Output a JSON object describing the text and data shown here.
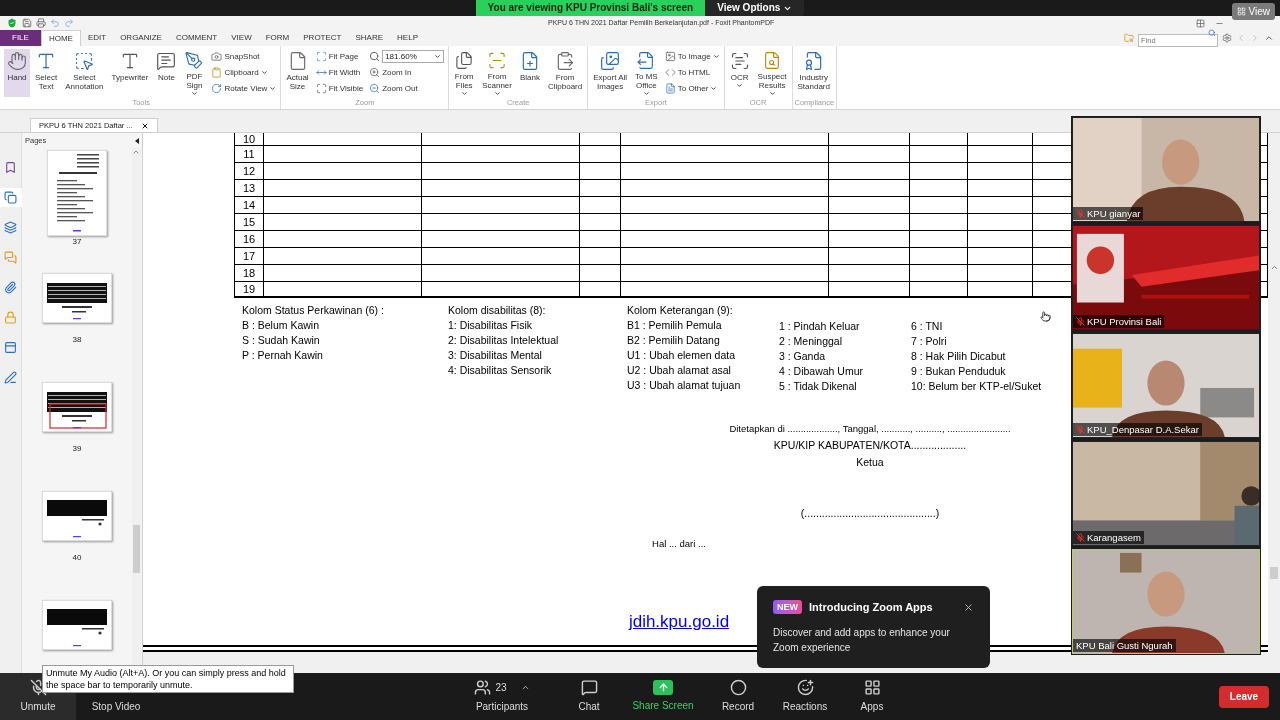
{
  "meeting": {
    "banner": "You are viewing KPU Provinsi Bali's screen",
    "view_options": "View Options",
    "view": "View"
  },
  "app": {
    "title": "PKPU 6 THN 2021 Daftar Pemilih Berkelanjutan.pdf - Foxit PhantomPDF",
    "menu_tabs": [
      {
        "label": "FILE",
        "kind": "file",
        "selected": false
      },
      {
        "label": "HOME",
        "kind": "tab",
        "selected": true
      },
      {
        "label": "EDIT",
        "kind": "tab",
        "selected": false
      },
      {
        "label": "ORGANIZE",
        "kind": "tab",
        "selected": false
      },
      {
        "label": "COMMENT",
        "kind": "tab",
        "selected": false
      },
      {
        "label": "VIEW",
        "kind": "tab",
        "selected": false
      },
      {
        "label": "FORM",
        "kind": "tab",
        "selected": false
      },
      {
        "label": "PROTECT",
        "kind": "tab",
        "selected": false
      },
      {
        "label": "SHARE",
        "kind": "tab",
        "selected": false
      },
      {
        "label": "HELP",
        "kind": "tab",
        "selected": false
      }
    ],
    "find": {
      "placeholder": "Find"
    },
    "ribbon_groups": [
      {
        "label": "Tools",
        "items": [
          {
            "kind": "large",
            "lines": [
              "Hand"
            ],
            "dropdown": false,
            "selected": true
          },
          {
            "kind": "large",
            "lines": [
              "Select",
              "Text"
            ],
            "dropdown": false,
            "selected": false
          },
          {
            "kind": "large",
            "lines": [
              "Select",
              "Annotation"
            ],
            "dropdown": false,
            "selected": false
          },
          {
            "kind": "large",
            "lines": [
              "Typewriter"
            ],
            "dropdown": false,
            "selected": false
          },
          {
            "kind": "large",
            "lines": [
              "Note"
            ],
            "dropdown": false,
            "selected": false
          },
          {
            "kind": "large",
            "lines": [
              "PDF",
              "Sign"
            ],
            "dropdown": true,
            "selected": false
          },
          {
            "kind": "stack",
            "rows": [
              {
                "label": "SnapShot",
                "dropdown": false
              },
              {
                "label": "Clipboard",
                "dropdown": true
              },
              {
                "label": "Rotate View",
                "dropdown": true
              }
            ]
          }
        ]
      },
      {
        "label": "Zoom",
        "items": [
          {
            "kind": "large",
            "lines": [
              "Actual",
              "Size"
            ],
            "dropdown": false,
            "selected": false
          },
          {
            "kind": "stack",
            "rows": [
              {
                "label": "Fit Page",
                "dropdown": false
              },
              {
                "label": "Fit Width",
                "dropdown": false
              },
              {
                "label": "Fit Visible",
                "dropdown": false
              }
            ]
          },
          {
            "kind": "zoom",
            "value": "181.60%",
            "rows": [
              {
                "label": "Zoom In",
                "dropdown": false
              },
              {
                "label": "Zoom Out",
                "dropdown": false
              }
            ]
          }
        ]
      },
      {
        "label": "Create",
        "items": [
          {
            "kind": "large",
            "lines": [
              "From",
              "Files"
            ],
            "dropdown": true,
            "selected": false
          },
          {
            "kind": "large",
            "lines": [
              "From",
              "Scanner"
            ],
            "dropdown": true,
            "selected": false
          },
          {
            "kind": "large",
            "lines": [
              "Blank"
            ],
            "dropdown": false,
            "selected": false
          },
          {
            "kind": "large",
            "lines": [
              "From",
              "Clipboard"
            ],
            "dropdown": false,
            "selected": false
          }
        ]
      },
      {
        "label": "Export",
        "items": [
          {
            "kind": "large",
            "lines": [
              "Export All",
              "Images"
            ],
            "dropdown": false,
            "selected": false
          },
          {
            "kind": "large",
            "lines": [
              "To MS",
              "Office"
            ],
            "dropdown": true,
            "selected": false
          },
          {
            "kind": "stack",
            "rows": [
              {
                "label": "To Image",
                "dropdown": true
              },
              {
                "label": "To HTML",
                "dropdown": false
              },
              {
                "label": "To Other",
                "dropdown": true
              }
            ]
          }
        ]
      },
      {
        "label": "OCR",
        "items": [
          {
            "kind": "large",
            "lines": [
              "OCR"
            ],
            "dropdown": true,
            "selected": false
          },
          {
            "kind": "large",
            "lines": [
              "Suspect",
              "Results"
            ],
            "dropdown": true,
            "selected": false
          }
        ]
      },
      {
        "label": "Compliance",
        "items": [
          {
            "kind": "large",
            "lines": [
              "Industry",
              "Standard"
            ],
            "dropdown": false,
            "selected": false
          }
        ]
      }
    ],
    "doc_tab": "PKPU 6 THN 2021 Daftar ...",
    "side_tools": [
      {
        "selected": false
      },
      {
        "selected": true
      },
      {
        "selected": false
      },
      {
        "selected": false
      },
      {
        "selected": false
      },
      {
        "selected": false
      },
      {
        "selected": false
      },
      {
        "selected": false
      }
    ],
    "pages_panel": {
      "title": "Pages",
      "thumbnails": [
        {
          "page": "37",
          "kind": "portrait",
          "selected": false
        },
        {
          "page": "38",
          "kind": "table",
          "selected": false
        },
        {
          "page": "39",
          "kind": "table",
          "selected": true
        },
        {
          "page": "40",
          "kind": "dark",
          "selected": false
        },
        {
          "kind": "dark",
          "selected": false
        }
      ]
    },
    "document": {
      "rows": [
        {
          "number": "10"
        },
        {
          "number": "11"
        },
        {
          "number": "12"
        },
        {
          "number": "13"
        },
        {
          "number": "14"
        },
        {
          "number": "15"
        },
        {
          "number": "16"
        },
        {
          "number": "17"
        },
        {
          "number": "18"
        },
        {
          "number": "19"
        }
      ],
      "legend": [
        {
          "title": "Kolom Status Perkawinan (6) :",
          "items": [
            "B : Belum Kawin",
            "S : Sudah Kawin",
            "P : Pernah Kawin"
          ]
        },
        {
          "title": "Kolom disabilitas (8):",
          "items": [
            "1: Disabilitas Fisik",
            "2: Disabilitas Intelektual",
            "3: Disabilitas Mental",
            "4: Disabilitas Sensorik"
          ]
        },
        {
          "title": "Kolom Keterangan (9):",
          "items": [
            "B1 : Pemilih Pemula",
            "B2 : Pemilih Datang",
            "U1 : Ubah elemen data",
            "U2 : Ubah alamat asal",
            "U3 : Ubah alamat tujuan"
          ]
        },
        {
          "items": [
            "1 : Pindah Keluar",
            "2 : Meninggal",
            "3 : Ganda",
            "4 : Dibawah Umur",
            "5 : Tidak Dikenal"
          ]
        },
        {
          "items": [
            "6 : TNI",
            "7 : Polri",
            "8 : Hak Pilih Dicabut",
            "9 : Bukan Penduduk",
            "10: Belum ber KTP-el/Suket"
          ]
        }
      ],
      "signature": {
        "place_date": "Ditetapkan di ..................., Tanggal, ..........., .........., ........................",
        "office": "KPU/KIP KABUPATEN/KOTA...................",
        "role": "Ketua",
        "name_line": "(.............................................)"
      },
      "page_footer": "Hal ... dari ...",
      "link": "jdih.kpu.go.id"
    }
  },
  "participants": [
    {
      "name": "KPU gianyar",
      "muted": true,
      "speaking": false
    },
    {
      "name": "KPU Provinsi Bali",
      "muted": true,
      "speaking": false
    },
    {
      "name": "KPU_Denpasar D.A.Sekar",
      "muted": true,
      "speaking": false
    },
    {
      "name": "Karangasem",
      "muted": true,
      "speaking": false
    },
    {
      "name": "KPU Bali Gusti Ngurah",
      "muted": false,
      "speaking": true
    }
  ],
  "toolbar": {
    "items": [
      {
        "kind": "unmute",
        "label": "Unmute"
      },
      {
        "kind": "video",
        "label": "Stop Video"
      },
      {
        "kind": "participants",
        "label": "Participants",
        "count": "23"
      },
      {
        "kind": "chat",
        "label": "Chat"
      },
      {
        "kind": "share",
        "label": "Share Screen"
      },
      {
        "kind": "record",
        "label": "Record"
      },
      {
        "kind": "reactions",
        "label": "Reactions"
      },
      {
        "kind": "apps",
        "label": "Apps"
      }
    ],
    "leave": "Leave"
  },
  "tooltip": "Unmute My Audio (Alt+A). Or you can simply press and hold the space bar to temporarily unmute.",
  "popup": {
    "badge": "NEW",
    "title": "Introducing Zoom Apps",
    "body": "Discover and add apps to enhance your Zoom experience"
  }
}
